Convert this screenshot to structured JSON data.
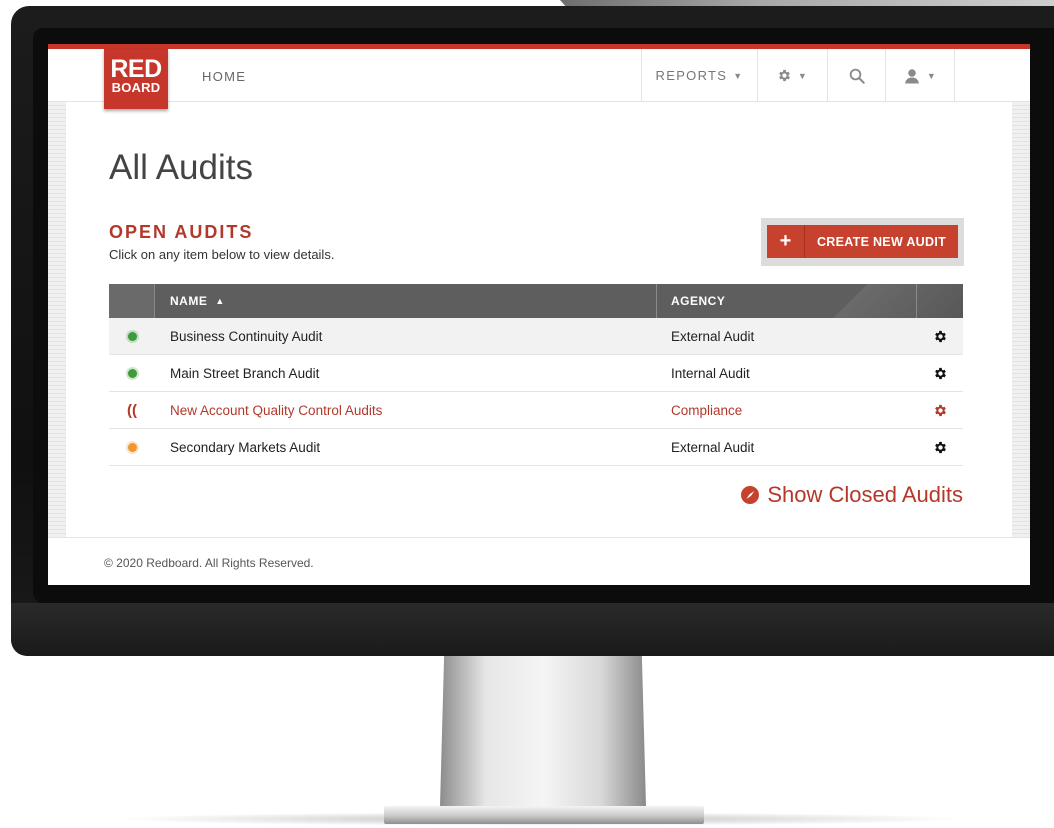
{
  "navbar": {
    "logo_line1": "RED",
    "logo_line2": "BOARD",
    "home_label": "HOME",
    "reports_label": "REPORTS",
    "settings_icon": "gear-icon",
    "search_icon": "search-icon",
    "user_icon": "user-icon"
  },
  "main": {
    "page_title": "All Audits",
    "section_title": "OPEN AUDITS",
    "section_subtitle": "Click on any item below to view details.",
    "create_button_label": "CREATE NEW AUDIT",
    "create_button_icon": "plus-icon",
    "show_closed_label": "Show Closed Audits"
  },
  "table": {
    "columns": [
      "NAME",
      "AGENCY"
    ],
    "sort_column": "NAME",
    "sort_direction": "ascending",
    "rows": [
      {
        "name": "Business Continuity Audit",
        "agency": "External Audit",
        "status": "green"
      },
      {
        "name": "Main Street Branch Audit",
        "agency": "Internal Audit",
        "status": "green"
      },
      {
        "name": "New Account Quality Control Audits",
        "agency": "Compliance",
        "status": "alert"
      },
      {
        "name": "Secondary Markets Audit",
        "agency": "External Audit",
        "status": "orange"
      }
    ]
  },
  "footer": {
    "copyright": "© 2020 Redboard. All Rights Reserved."
  },
  "colors": {
    "brand_red": "#c6362b",
    "header_gray": "#5e5e5e",
    "status_green": "#3e9a3a",
    "status_orange": "#f0962d"
  }
}
